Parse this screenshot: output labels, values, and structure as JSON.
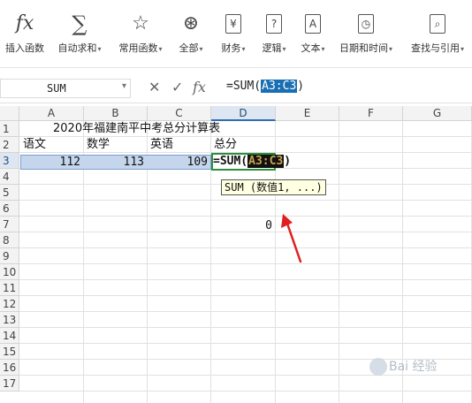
{
  "ribbon": {
    "items": [
      {
        "label": "插入函数",
        "icon": "fx-icon",
        "dropdown": false
      },
      {
        "label": "自动求和",
        "icon": "sigma-icon",
        "dropdown": true
      },
      {
        "label": "常用函数",
        "icon": "star-icon",
        "dropdown": true
      },
      {
        "label": "全部",
        "icon": "asterisk-circle-icon",
        "dropdown": true
      },
      {
        "label": "财务",
        "icon": "yen-icon",
        "dropdown": true
      },
      {
        "label": "逻辑",
        "icon": "question-icon",
        "dropdown": true
      },
      {
        "label": "文本",
        "icon": "text-a-icon",
        "dropdown": true
      },
      {
        "label": "日期和时间",
        "icon": "clock-icon",
        "dropdown": true
      },
      {
        "label": "查找与引用",
        "icon": "search-doc-icon",
        "dropdown": true
      }
    ],
    "glyphs": {
      "fx": "fx",
      "sigma": "∑",
      "star": "☆",
      "asterisk": "⊛",
      "yen": "¥",
      "question": "?",
      "textA": "A",
      "clock": "◷",
      "search": "⌕",
      "dropdown": "▾"
    }
  },
  "formula_bar": {
    "name_box": "SUM",
    "name_dropdown": "▾",
    "cancel": "✕",
    "confirm": "✓",
    "fx": "fx",
    "formula_prefix": "=SUM(",
    "formula_ref": "A3:C3",
    "formula_suffix": ")"
  },
  "grid": {
    "columns": [
      "A",
      "B",
      "C",
      "D",
      "E",
      "F",
      "G"
    ],
    "active_column": "D",
    "rows": [
      "1",
      "2",
      "3",
      "4",
      "5",
      "6",
      "7",
      "8",
      "9",
      "10",
      "11",
      "12",
      "13",
      "14",
      "15",
      "16",
      "17"
    ],
    "active_row": "3",
    "cells": {
      "title": "2020年福建南平中考总分计算表",
      "b_yuwen": "语文",
      "b_shuxue": "数学",
      "b_yingyu": "英语",
      "b_zongfen": "总分",
      "a3": "112",
      "b3": "113",
      "c3": "109",
      "d7": "0"
    },
    "edit_formula": {
      "prefix": "=SUM(",
      "ref": "A3:C3",
      "suffix": ")"
    },
    "tooltip": "SUM (数值1, ...)"
  },
  "annotation": {
    "arrow_color": "#e02020"
  },
  "watermark": {
    "text": "Bai 经验"
  }
}
